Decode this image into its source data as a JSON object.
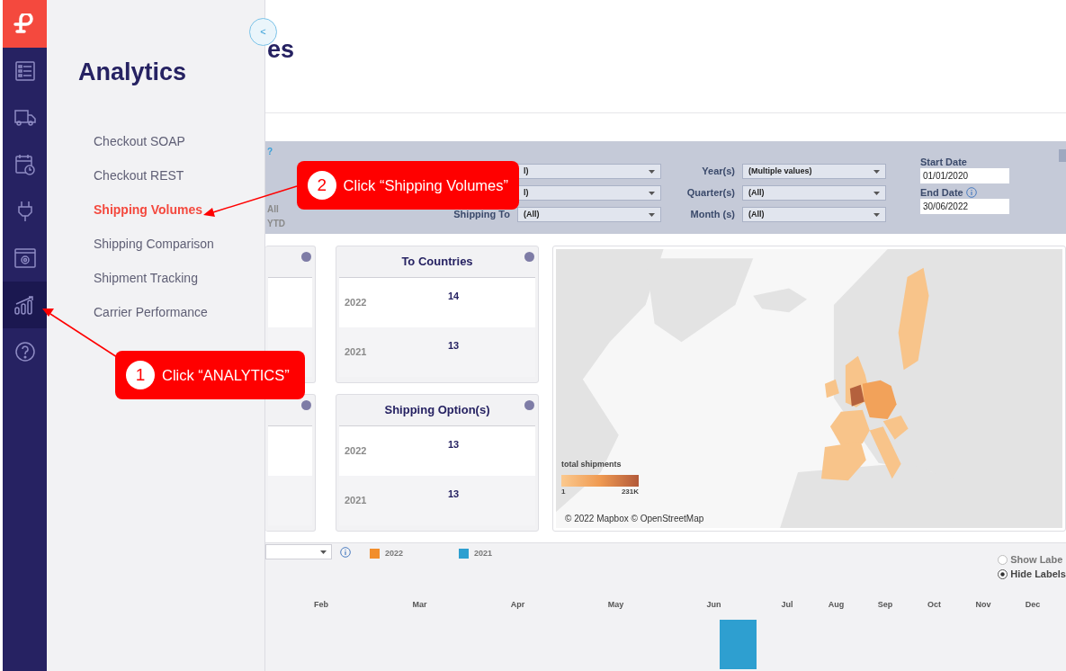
{
  "rail": {
    "items": [
      {
        "selected": false
      },
      {
        "selected": false
      },
      {
        "selected": false
      },
      {
        "selected": false
      },
      {
        "selected": false
      },
      {
        "selected": true
      },
      {
        "selected": false
      }
    ]
  },
  "flyout": {
    "title": "Analytics",
    "collapse": "<",
    "items": [
      {
        "label": "Checkout SOAP",
        "selected": false
      },
      {
        "label": "Checkout REST",
        "selected": false
      },
      {
        "label": "Shipping Volumes",
        "selected": true
      },
      {
        "label": "Shipping Comparison",
        "selected": false
      },
      {
        "label": "Shipment Tracking",
        "selected": false
      },
      {
        "label": "Carrier Performance",
        "selected": false
      }
    ]
  },
  "page": {
    "title": "es"
  },
  "filters": {
    "help": "?",
    "period": [
      "All",
      "YTD"
    ],
    "groups": [
      {
        "rows": [
          {
            "value": "l)"
          },
          {
            "value": "l)"
          },
          {
            "label": "Shipping To",
            "value": "(All)"
          }
        ]
      },
      {
        "rows": [
          {
            "label": "Year(s)",
            "value": "(Multiple values)"
          },
          {
            "label": "Quarter(s)",
            "value": "(All)"
          },
          {
            "label": "Month (s)",
            "value": "(All)"
          }
        ]
      }
    ],
    "dates": [
      {
        "label": "Start Date",
        "value": "01/01/2020",
        "info": false
      },
      {
        "label": "End Date",
        "value": "30/06/2022",
        "info": true
      }
    ]
  },
  "cards": [
    {
      "kind": "partial"
    },
    {
      "kind": "full",
      "title": "To Countries",
      "rows": [
        {
          "year": "2022",
          "value": "14"
        },
        {
          "year": "2021",
          "value": "13"
        }
      ]
    },
    {
      "kind": "partial"
    },
    {
      "kind": "full",
      "title": "Shipping Option(s)",
      "rows": [
        {
          "year": "2022",
          "value": "13"
        },
        {
          "year": "2021",
          "value": "13"
        }
      ]
    }
  ],
  "map": {
    "legend_title": "total shipments",
    "legend_min": "1",
    "legend_max": "231K",
    "credits": "© 2022 Mapbox © OpenStreetMap"
  },
  "timeline": {
    "legend": [
      {
        "label": "2022",
        "color": "#f28e2b"
      },
      {
        "label": "2021",
        "color": "#2e9fd0"
      }
    ],
    "label_options": [
      {
        "label": "Show Labe",
        "selected": false
      },
      {
        "label": "Hide Labels",
        "selected": true
      }
    ],
    "months": [
      {
        "label": "Feb",
        "bar": false
      },
      {
        "label": "Mar",
        "bar": false
      },
      {
        "label": "Apr",
        "bar": false
      },
      {
        "label": "May",
        "bar": false
      },
      {
        "label": "Jun",
        "bar": true
      },
      {
        "label": "Jul",
        "bar": false
      },
      {
        "label": "Aug",
        "bar": false
      },
      {
        "label": "Sep",
        "bar": false
      },
      {
        "label": "Oct",
        "bar": false
      },
      {
        "label": "Nov",
        "bar": false
      },
      {
        "label": "Dec",
        "bar": false
      }
    ]
  },
  "callouts": [
    {
      "number": "1",
      "text": "Click “ANALYTICS”"
    },
    {
      "number": "2",
      "text": "Click “Shipping Volumes”"
    }
  ]
}
